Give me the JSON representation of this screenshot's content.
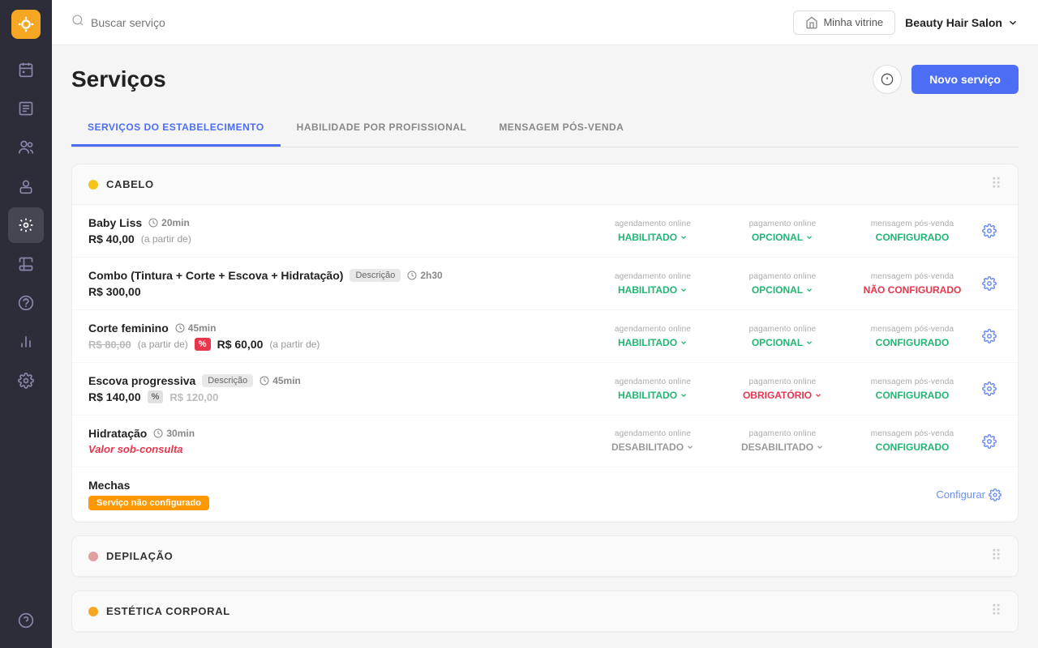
{
  "topbar": {
    "search_placeholder": "Buscar serviço",
    "vitrine_label": "Minha vitrine",
    "salon_name": "Beauty Hair Salon"
  },
  "page": {
    "title": "Serviços",
    "novo_btn": "Novo serviço"
  },
  "tabs": [
    {
      "id": "servicos",
      "label": "SERVIÇOS DO ESTABELECIMENTO",
      "active": true
    },
    {
      "id": "habilidade",
      "label": "HABILIDADE POR PROFISSIONAL",
      "active": false
    },
    {
      "id": "mensagem",
      "label": "MENSAGEM PÓS-VENDA",
      "active": false
    }
  ],
  "categories": [
    {
      "id": "cabelo",
      "name": "CABELO",
      "dot_color": "#f5c518",
      "services": [
        {
          "name": "Baby Liss",
          "duration": "20min",
          "price": "R$ 40,00",
          "price_suffix": "(a partir de)",
          "agendamento": "HABILITADO",
          "agendamento_status": "green",
          "pagamento": "OPCIONAL",
          "pagamento_status": "green",
          "mensagem": "CONFIGURADO",
          "mensagem_status": "green",
          "type": "normal"
        },
        {
          "name": "Combo (Tintura + Corte + Escova + Hidratação)",
          "has_desc": true,
          "duration": "2h30",
          "price": "R$ 300,00",
          "agendamento": "HABILITADO",
          "agendamento_status": "green",
          "pagamento": "OPCIONAL",
          "pagamento_status": "green",
          "mensagem": "NÃO CONFIGURADO",
          "mensagem_status": "orange",
          "type": "normal"
        },
        {
          "name": "Corte feminino",
          "duration": "45min",
          "price_strikethrough": "R$ 80,00",
          "price_suffix_before": "(a partir de)",
          "discount": true,
          "price": "R$ 60,00",
          "price_suffix": "(a partir de)",
          "agendamento": "HABILITADO",
          "agendamento_status": "green",
          "pagamento": "OPCIONAL",
          "pagamento_status": "green",
          "mensagem": "CONFIGURADO",
          "mensagem_status": "green",
          "type": "discount"
        },
        {
          "name": "Escova progressiva",
          "has_desc": true,
          "duration": "45min",
          "price": "R$ 140,00",
          "price_discounted": "R$ 120,00",
          "agendamento": "HABILITADO",
          "agendamento_status": "green",
          "pagamento": "OBRIGATÓRIO",
          "pagamento_status": "orange",
          "mensagem": "CONFIGURADO",
          "mensagem_status": "green",
          "type": "percent"
        },
        {
          "name": "Hidratação",
          "duration": "30min",
          "valor_consulta": "Valor sob-consulta",
          "agendamento": "DESABILITADO",
          "agendamento_status": "gray",
          "pagamento": "DESABILITADO",
          "pagamento_status": "gray",
          "mensagem": "CONFIGURADO",
          "mensagem_status": "green",
          "type": "consulta"
        },
        {
          "name": "Mechas",
          "not_configured": "Serviço não configurado",
          "configurar_label": "Configurar",
          "type": "not_configured"
        }
      ]
    },
    {
      "id": "depilacao",
      "name": "DEPILAÇÃO",
      "dot_color": "#e0a0a0",
      "services": []
    },
    {
      "id": "estetica",
      "name": "ESTÉTICA CORPORAL",
      "dot_color": "#f5a623",
      "services": []
    }
  ],
  "sidebar": {
    "items": [
      {
        "id": "calendar",
        "label": "Agenda",
        "active": false
      },
      {
        "id": "reports",
        "label": "Relatórios",
        "active": false
      },
      {
        "id": "clients",
        "label": "Clientes",
        "active": false
      },
      {
        "id": "professionals",
        "label": "Profissionais",
        "active": false
      },
      {
        "id": "services",
        "label": "Serviços",
        "active": true
      },
      {
        "id": "products",
        "label": "Produtos",
        "active": false
      },
      {
        "id": "financial",
        "label": "Financeiro",
        "active": false
      },
      {
        "id": "stats",
        "label": "Estatísticas",
        "active": false
      },
      {
        "id": "settings",
        "label": "Configurações",
        "active": false
      }
    ]
  },
  "meta_labels": {
    "agendamento": "agendamento online",
    "pagamento": "pagamento online",
    "mensagem": "mensagem pós-venda"
  }
}
